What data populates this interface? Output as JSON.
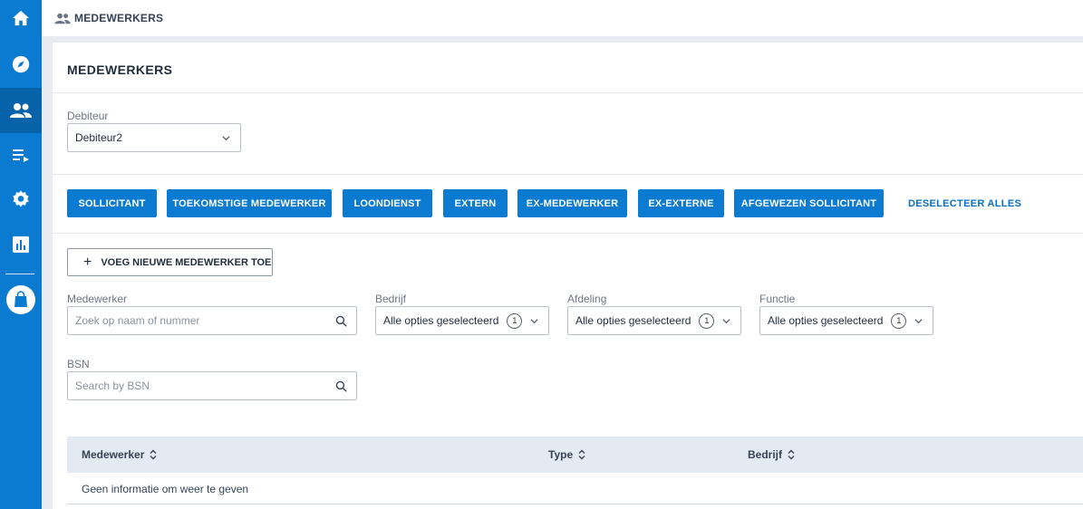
{
  "sidebar": {
    "items": [
      {
        "icon": "home-icon",
        "active": false
      },
      {
        "icon": "compass-icon",
        "active": false
      },
      {
        "icon": "people-icon",
        "active": true
      },
      {
        "icon": "list-play-icon",
        "active": false
      },
      {
        "icon": "gear-icon",
        "active": false
      },
      {
        "icon": "bar-chart-icon",
        "active": false
      },
      {
        "icon": "shopping-bag-icon",
        "active": false
      }
    ]
  },
  "breadcrumb": {
    "icon": "people-icon",
    "label": "MEDEWERKERS"
  },
  "page": {
    "title": "MEDEWERKERS"
  },
  "debiteur": {
    "label": "Debiteur",
    "value": "Debiteur2"
  },
  "filter_buttons": [
    "SOLLICITANT",
    "TOEKOMSTIGE MEDEWERKER",
    "LOONDIENST",
    "EXTERN",
    "EX-MEDEWERKER",
    "EX-EXTERNE",
    "AFGEWEZEN SOLLICITANT"
  ],
  "deselect_all": "DESELECTEER ALLES",
  "add_employee": "VOEG NIEUWE MEDEWERKER TOE",
  "filters": {
    "medewerker": {
      "label": "Medewerker",
      "placeholder": "Zoek op naam of nummer"
    },
    "bedrijf": {
      "label": "Bedrijf",
      "value": "Alle opties geselecteerd",
      "count": "1"
    },
    "afdeling": {
      "label": "Afdeling",
      "value": "Alle opties geselecteerd",
      "count": "1"
    },
    "functie": {
      "label": "Functie",
      "value": "Alle opties geselecteerd",
      "count": "1"
    },
    "bsn": {
      "label": "BSN",
      "placeholder": "Search by BSN"
    }
  },
  "table": {
    "columns": [
      "Medewerker",
      "Type",
      "Bedrijf"
    ],
    "empty_text": "Geen informatie om weer te geven"
  },
  "colors": {
    "primary": "#0a7bd0",
    "sidebar_active": "#0663aa",
    "table_header": "#e4eaf2"
  }
}
